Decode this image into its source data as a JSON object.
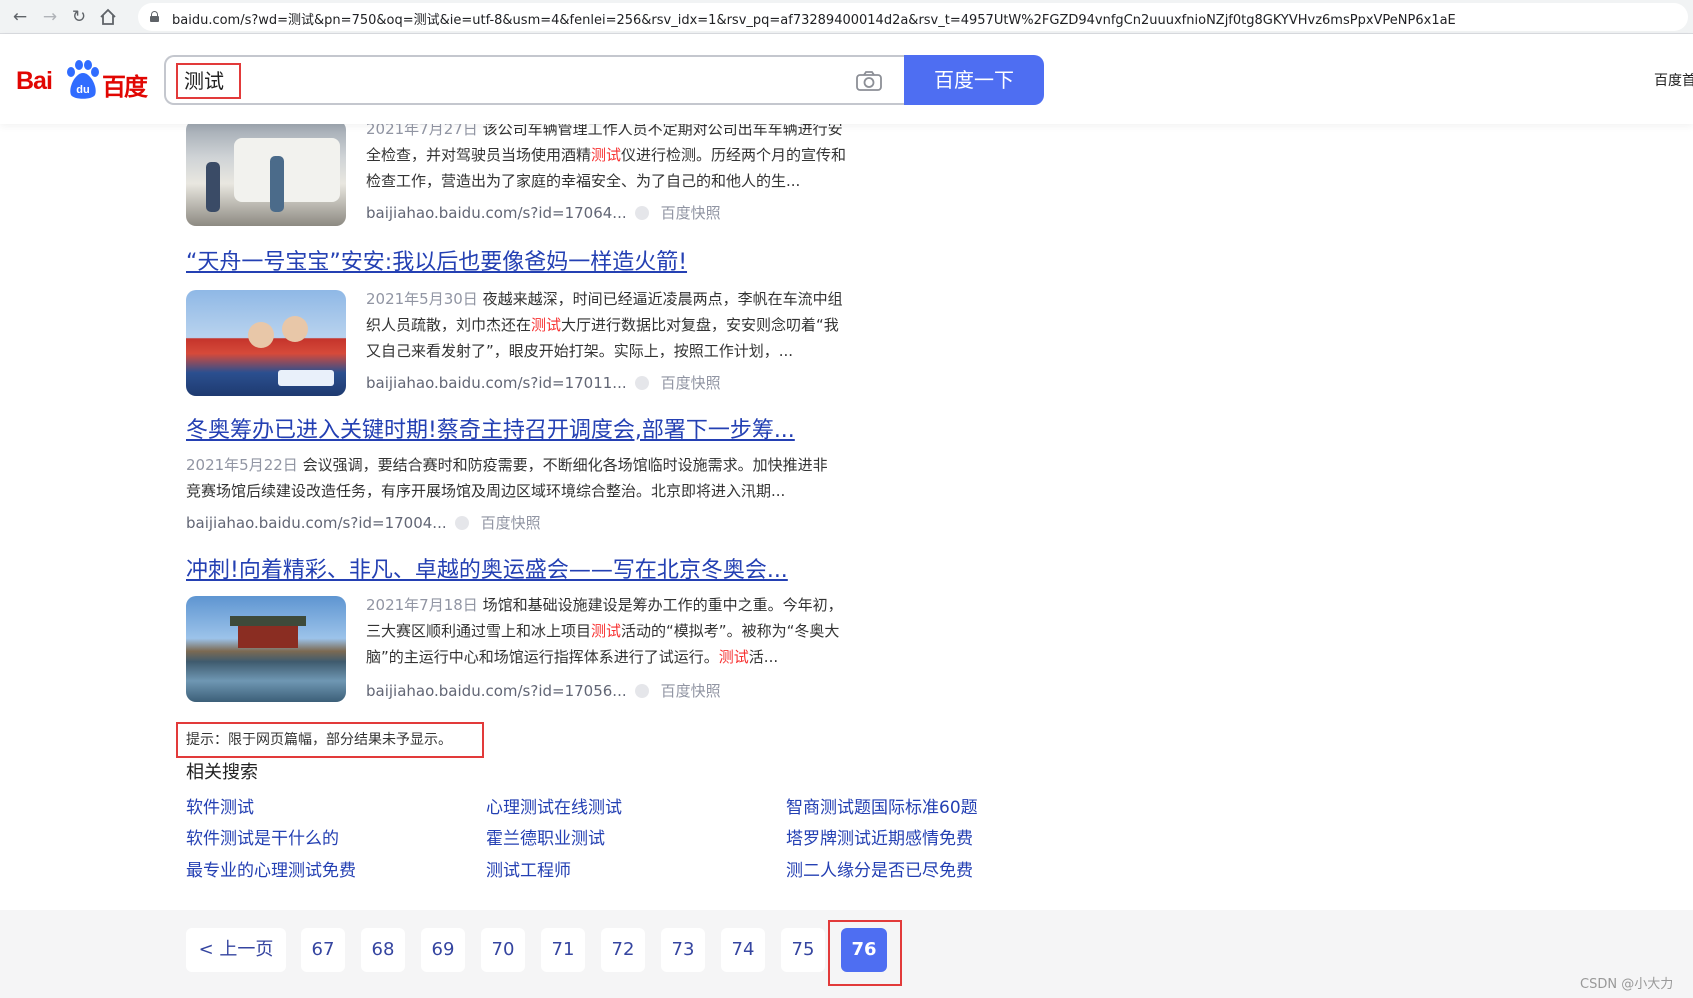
{
  "browser": {
    "url": "baidu.com/s?wd=测试&pn=750&oq=测试&ie=utf-8&usm=4&fenlei=256&rsv_idx=1&rsv_pq=af73289400014d2a&rsv_t=4957UtW%2FGZD94vnfgCn2uuuxfnioNZjf0tg8GKYVHvz6msPpxVPeNP6x1aE"
  },
  "header": {
    "logo_bai": "Bai",
    "logo_du_text": "du",
    "logo_cn": "百度",
    "search_value": "测试",
    "search_button": "百度一下",
    "right_link": "百度首"
  },
  "results": [
    {
      "date": "2021年7月27日",
      "text_1": "该公司车辆管理工作人员不定期对公司出车车辆进行安",
      "text_2a": "全检查，并对驾驶员当场使用酒精",
      "text_2hl": "测试",
      "text_2b": "仪进行检测。历经两个月的宣传和",
      "text_3": "检查工作，营造出为了家庭的幸福安全、为了自己的和他人的生...",
      "url": "baijiahao.baidu.com/s?id=17064...",
      "snapshot": "百度快照"
    },
    {
      "title": "“天舟一号宝宝”安安:我以后也要像爸妈一样造火箭!",
      "date": "2021年5月30日",
      "text_1": "夜越来越深，时间已经逼近凌晨两点，李帆在车流中组",
      "text_2a": "织人员疏散，刘巾杰还在",
      "text_2hl": "测试",
      "text_2b": "大厅进行数据比对复盘，安安则念叨着“我",
      "text_3": "又自己来看发射了”，眼皮开始打架。实际上，按照工作计划，...",
      "url": "baijiahao.baidu.com/s?id=17011...",
      "snapshot": "百度快照"
    },
    {
      "title": "冬奥筹办已进入关键时期!蔡奇主持召开调度会,部署下一步筹...",
      "date": "2021年5月22日",
      "text_1": "会议强调，要结合赛时和防疫需要，不断细化各场馆临时设施需求。加快推进非",
      "text_2": "竞赛场馆后续建设改造任务，有序开展场馆及周边区域环境综合整治。北京即将进入汛期...",
      "url": "baijiahao.baidu.com/s?id=17004...",
      "snapshot": "百度快照"
    },
    {
      "title": "冲刺!向着精彩、非凡、卓越的奥运盛会——写在北京冬奥会...",
      "date": "2021年7月18日",
      "text_1": "场馆和基础设施建设是筹办工作的重中之重。今年初，",
      "text_2a": "三大赛区顺利通过雪上和冰上项目",
      "text_2hl": "测试",
      "text_2b": "活动的“模拟考”。被称为“冬奥大",
      "text_3a": "脑”的主运行中心和场馆运行指挥体系进行了试运行。",
      "text_3hl": "测试",
      "text_3b": "活...",
      "url": "baijiahao.baidu.com/s?id=17056...",
      "snapshot": "百度快照"
    }
  ],
  "hint": "提示：限于网页篇幅，部分结果未予显示。",
  "related": {
    "title": "相关搜索",
    "links": [
      "软件测试",
      "心理测试在线测试",
      "智商测试题国际标准60题",
      "软件测试是干什么的",
      "霍兰德职业测试",
      "塔罗牌测试近期感情免费",
      "最专业的心理测试免费",
      "测试工程师",
      "测二人缘分是否已尽免费"
    ]
  },
  "pagination": {
    "prev": "< 上一页",
    "pages": [
      "67",
      "68",
      "69",
      "70",
      "71",
      "72",
      "73",
      "74",
      "75"
    ],
    "current": "76"
  },
  "watermark": "CSDN @小大力",
  "colors": {
    "brand_blue": "#4e6ef2",
    "link": "#2440b3",
    "highlight": "#f73131",
    "annotation_red": "#e23a3a"
  }
}
